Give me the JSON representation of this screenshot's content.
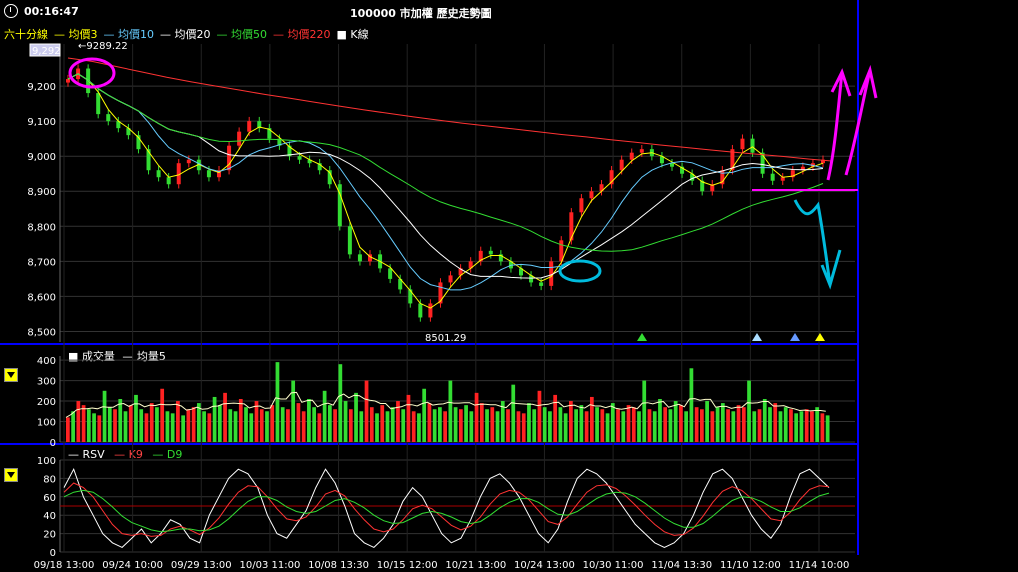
{
  "header": {
    "time": "00:16:47",
    "title": "100000 市加權  歷史走勢圖"
  },
  "legend": {
    "items": [
      {
        "label": "六十分線",
        "color": "#ffff00"
      },
      {
        "label": "— 均價3",
        "color": "#ffff00"
      },
      {
        "label": "— 均價10",
        "color": "#66ccff"
      },
      {
        "label": "— 均價20",
        "color": "#ffffff"
      },
      {
        "label": "— 均價50",
        "color": "#33dd33"
      },
      {
        "label": "— 均價220",
        "color": "#ff3333"
      },
      {
        "label": "■ K線",
        "color": "#ffffff"
      }
    ]
  },
  "price_labels": {
    "high_marker": "9289.22",
    "low_marker": "8501.29",
    "current_box": "9,292"
  },
  "volume_legend": {
    "vol": "■ 成交量",
    "ma": "— 均量5"
  },
  "kd_legend": {
    "rsv": "— RSV",
    "k": "— K9",
    "d": "— D9"
  },
  "colors": {
    "up": "#ff2222",
    "down": "#33dd33",
    "ma3": "#ffff00",
    "ma10": "#66ccff",
    "ma20": "#ffffff",
    "ma50": "#33dd33",
    "ma220": "#ff3333",
    "grid": "#333333",
    "separator": "#0000ff",
    "annotation_magenta": "#ff00ff",
    "annotation_cyan": "#00bbdd"
  },
  "chart_data": [
    {
      "type": "candlestick",
      "title": "100000 市加權  歷史走勢圖",
      "ylim": [
        8470,
        9320
      ],
      "yticks": [
        8500,
        8600,
        8700,
        8800,
        8900,
        9000,
        9100,
        9200
      ],
      "ytick_labels": [
        "8,500",
        "8,600",
        "8,700",
        "8,800",
        "8,900",
        "9,000",
        "9,100",
        "9,200"
      ],
      "x_dates": [
        "09/18 13:00",
        "09/24 10:00",
        "09/29 13:00",
        "10/03 11:00",
        "10/08 13:30",
        "10/15 12:00",
        "10/21 13:00",
        "10/24 13:00",
        "10/30 11:00",
        "11/04 13:30",
        "11/10 12:00",
        "11/14 10:00"
      ],
      "close_path": [
        9220,
        9250,
        9180,
        9120,
        9100,
        9080,
        9060,
        9020,
        8960,
        8940,
        8920,
        8980,
        8990,
        8960,
        8940,
        8960,
        9030,
        9070,
        9100,
        9080,
        9050,
        9030,
        9000,
        8990,
        8980,
        8960,
        8920,
        8800,
        8720,
        8700,
        8720,
        8680,
        8650,
        8620,
        8580,
        8540,
        8580,
        8640,
        8660,
        8680,
        8700,
        8730,
        8720,
        8700,
        8680,
        8660,
        8640,
        8630,
        8700,
        8760,
        8840,
        8880,
        8900,
        8920,
        8960,
        8990,
        9010,
        9020,
        9000,
        8980,
        8970,
        8950,
        8930,
        8900,
        8920,
        8960,
        9020,
        9050,
        9010,
        8950,
        8930,
        8940,
        8960,
        8970,
        8980,
        8990
      ],
      "ma220_path": [
        9280,
        9270,
        9255,
        9240,
        9225,
        9212,
        9200,
        9188,
        9176,
        9165,
        9154,
        9143,
        9132,
        9122,
        9112,
        9103,
        9094,
        9086,
        9078,
        9070,
        9062,
        9055,
        9047,
        9040,
        9032,
        9025,
        9018,
        9011,
        9005,
        8999,
        8992,
        8986
      ],
      "markers": [
        {
          "label": "▲",
          "color": "#33dd33"
        },
        {
          "label": "▲",
          "color": "#aaddff"
        },
        {
          "label": "▲",
          "color": "#6699ff"
        },
        {
          "label": "▲",
          "color": "#ffff00"
        }
      ]
    },
    {
      "type": "bar",
      "title": "成交量",
      "ylim": [
        0,
        420
      ],
      "yticks": [
        0,
        100,
        200,
        300,
        400
      ],
      "ytick_labels": [
        "0",
        "100",
        "200",
        "300",
        "400"
      ],
      "values": [
        120,
        150,
        200,
        180,
        160,
        140,
        130,
        250,
        170,
        160,
        210,
        150,
        180,
        230,
        160,
        140,
        190,
        170,
        260,
        150,
        140,
        200,
        130,
        160,
        170,
        190,
        150,
        140,
        220,
        180,
        240,
        160,
        150,
        210,
        170,
        140,
        200,
        160,
        150,
        180,
        390,
        170,
        160,
        300,
        190,
        150,
        210,
        170,
        140,
        250,
        180,
        160,
        380,
        200,
        160,
        240,
        150,
        300,
        170,
        140,
        180,
        150,
        170,
        200,
        160,
        230,
        150,
        140,
        260,
        190,
        160,
        170,
        150,
        300,
        170,
        160,
        180,
        150,
        240,
        190,
        160,
        170,
        150,
        200,
        160,
        280,
        150,
        140,
        190,
        160,
        250,
        170,
        150,
        230,
        170,
        140,
        200,
        160,
        180,
        150,
        220,
        170,
        160,
        140,
        190,
        160,
        150,
        180,
        170,
        150,
        300,
        160,
        150,
        210,
        170,
        160,
        200,
        180,
        150,
        360,
        170,
        160,
        200,
        150,
        170,
        190,
        160,
        150,
        180,
        170,
        300,
        150,
        160,
        210,
        170,
        190,
        150,
        170,
        160,
        140,
        150,
        160,
        150,
        170,
        140,
        130
      ]
    },
    {
      "type": "line",
      "title": "KD",
      "ylim": [
        0,
        100
      ],
      "yticks": [
        0,
        20,
        40,
        60,
        80,
        100
      ],
      "ytick_labels": [
        "0",
        "20",
        "40",
        "60",
        "80",
        "100"
      ],
      "series": [
        {
          "name": "RSV",
          "values": [
            70,
            90,
            60,
            40,
            20,
            10,
            5,
            15,
            25,
            10,
            20,
            35,
            30,
            15,
            10,
            40,
            60,
            80,
            90,
            85,
            70,
            40,
            20,
            15,
            30,
            45,
            70,
            90,
            75,
            50,
            20,
            10,
            5,
            15,
            30,
            55,
            70,
            60,
            40,
            20,
            10,
            15,
            35,
            60,
            80,
            85,
            75,
            60,
            40,
            20,
            10,
            25,
            55,
            80,
            90,
            85,
            75,
            60,
            45,
            30,
            20,
            10,
            5,
            10,
            20,
            40,
            65,
            85,
            90,
            80,
            60,
            40,
            25,
            15,
            30,
            60,
            85,
            90,
            80,
            70
          ]
        },
        {
          "name": "K9",
          "values": [
            65,
            75,
            70,
            60,
            45,
            30,
            20,
            18,
            20,
            17,
            18,
            25,
            28,
            24,
            19,
            26,
            37,
            52,
            65,
            72,
            71,
            60,
            47,
            36,
            34,
            38,
            49,
            63,
            67,
            61,
            47,
            35,
            25,
            22,
            25,
            35,
            47,
            51,
            47,
            38,
            29,
            24,
            28,
            38,
            52,
            63,
            67,
            65,
            57,
            45,
            33,
            30,
            38,
            52,
            65,
            72,
            73,
            69,
            61,
            51,
            40,
            30,
            22,
            18,
            19,
            26,
            39,
            54,
            66,
            71,
            67,
            58,
            47,
            36,
            34,
            43,
            57,
            68,
            72,
            71
          ]
        },
        {
          "name": "D9",
          "values": [
            60,
            65,
            67,
            65,
            58,
            49,
            39,
            32,
            28,
            24,
            22,
            23,
            25,
            25,
            23,
            24,
            28,
            36,
            46,
            55,
            60,
            60,
            56,
            49,
            44,
            42,
            44,
            50,
            56,
            58,
            54,
            48,
            40,
            34,
            31,
            32,
            37,
            42,
            44,
            42,
            38,
            33,
            31,
            33,
            40,
            48,
            54,
            58,
            58,
            54,
            47,
            41,
            40,
            44,
            51,
            58,
            63,
            65,
            64,
            60,
            53,
            45,
            37,
            31,
            27,
            27,
            31,
            39,
            48,
            56,
            60,
            59,
            55,
            49,
            44,
            44,
            48,
            55,
            61,
            64
          ]
        }
      ]
    }
  ],
  "dividers": {
    "ref_line_kd": 50
  }
}
